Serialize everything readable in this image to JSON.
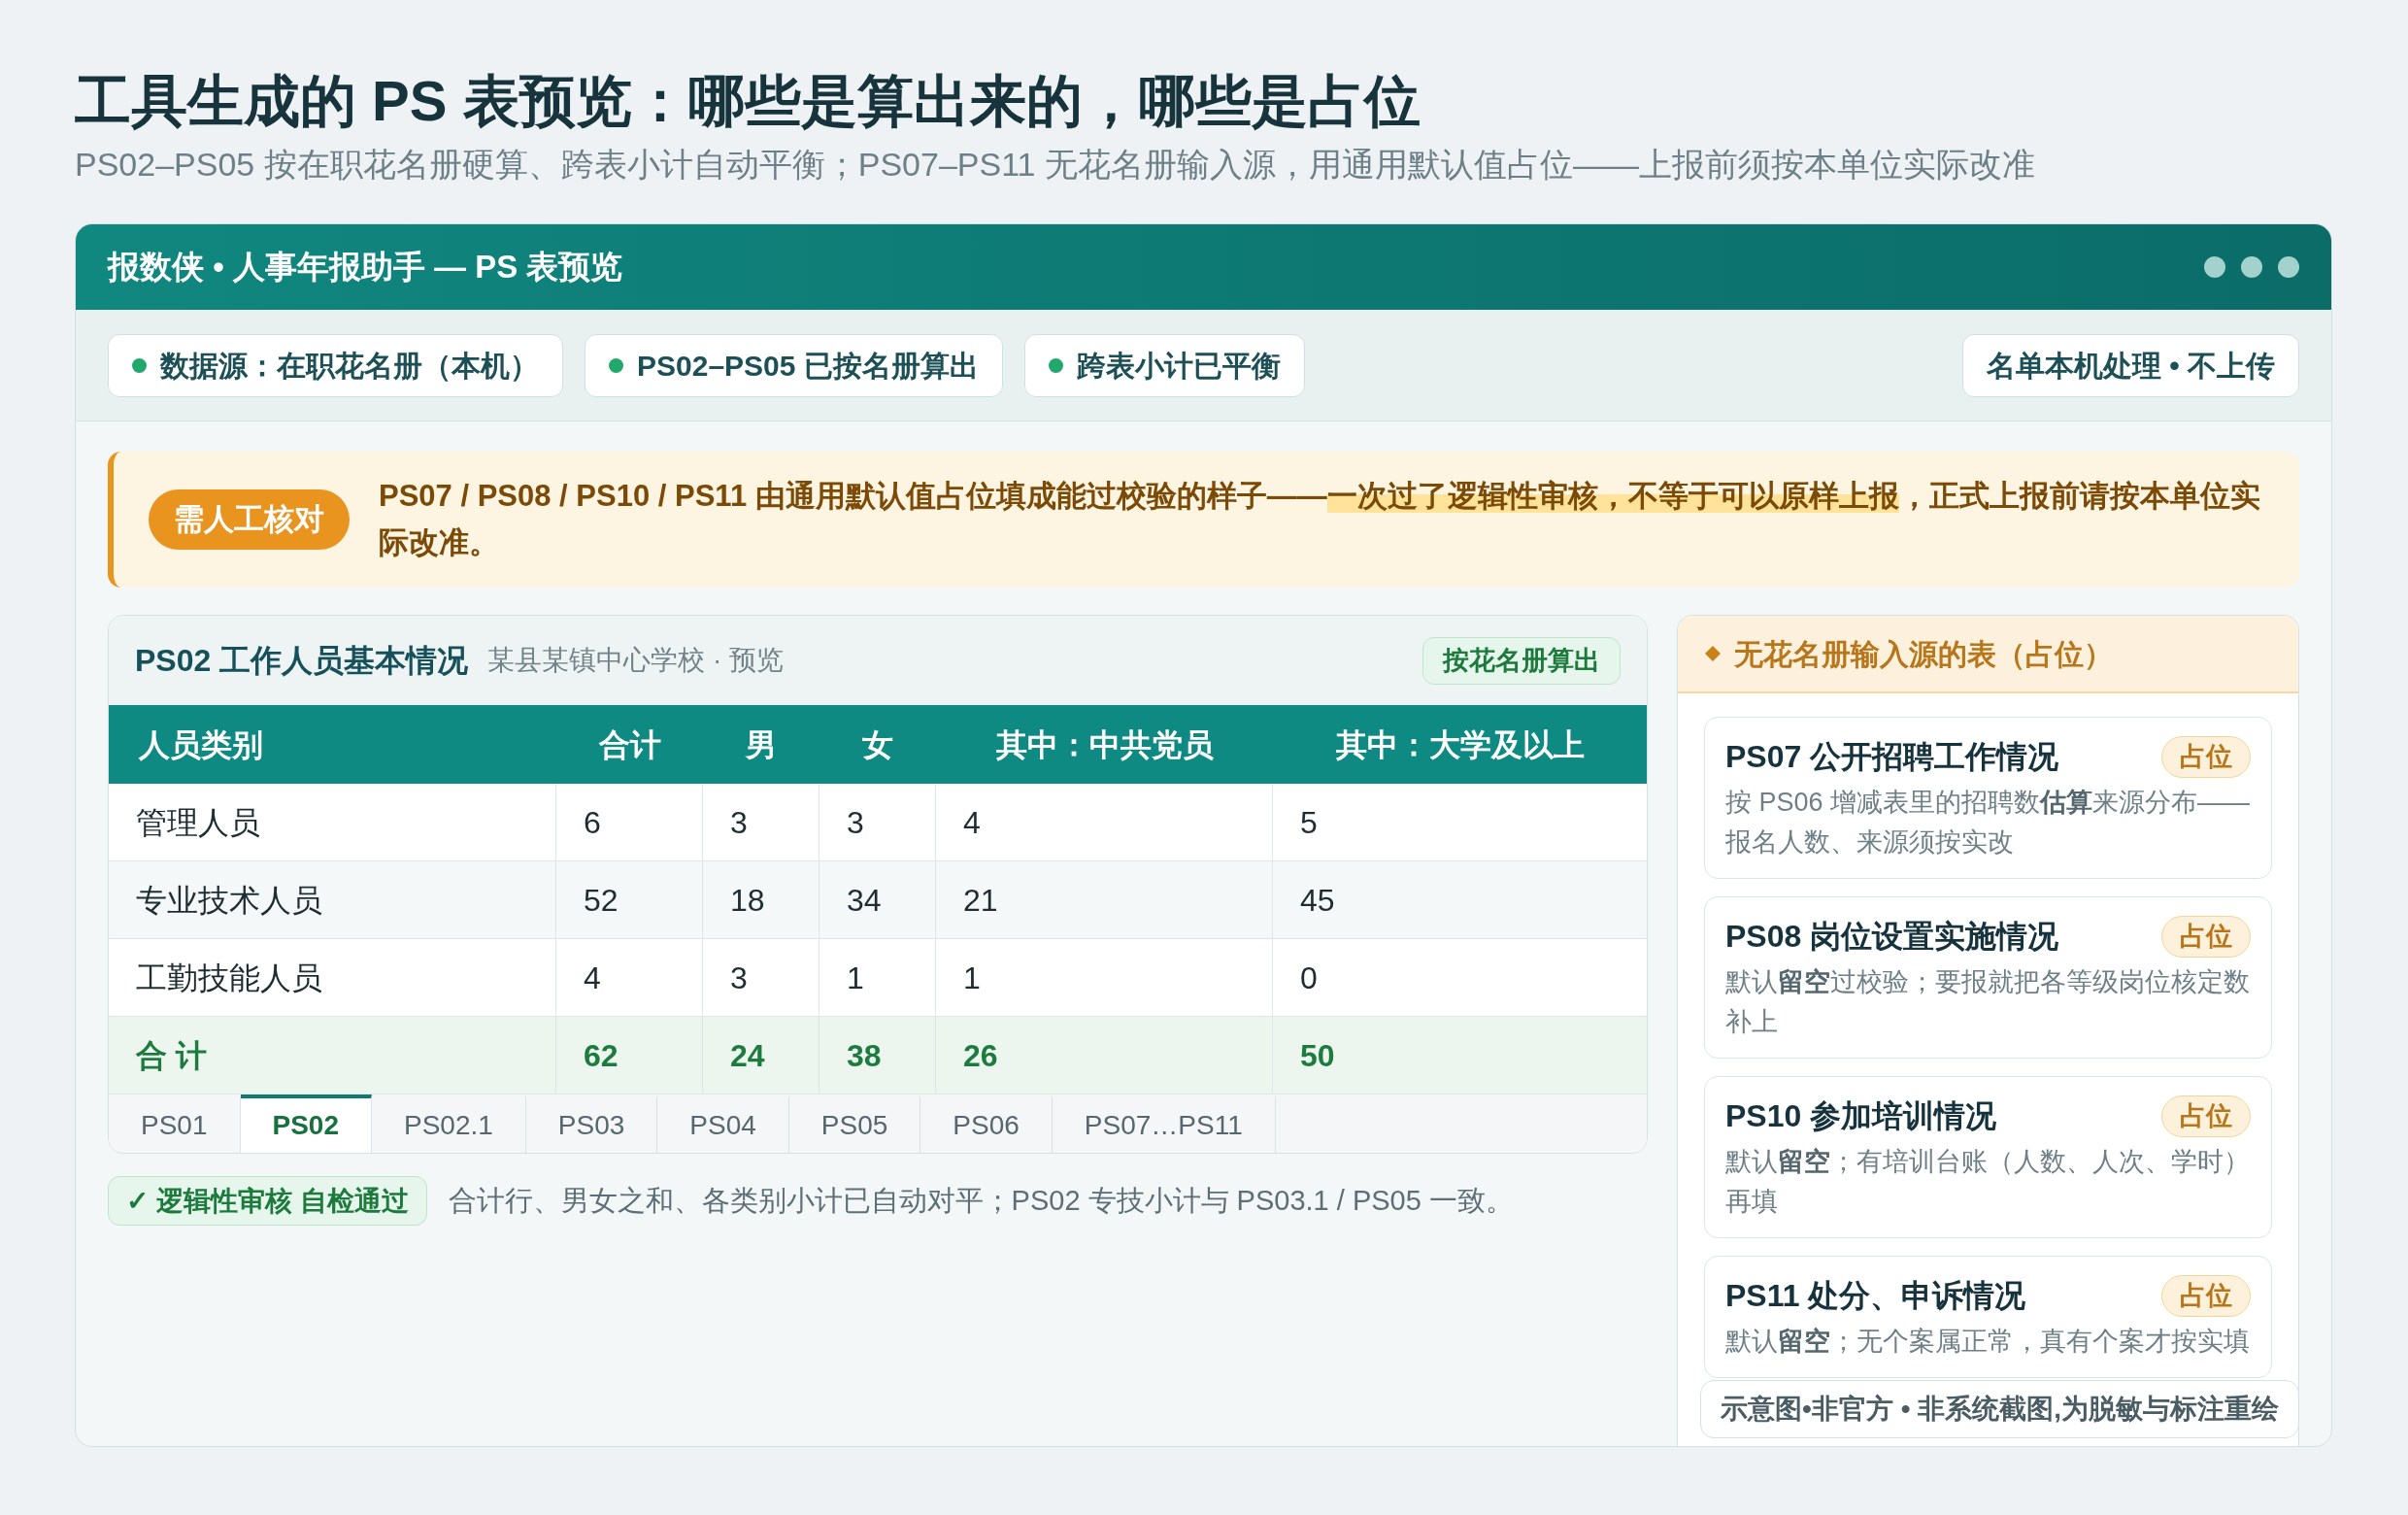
{
  "page": {
    "title": "工具生成的 PS 表预览：哪些是算出来的，哪些是占位",
    "subtitle": "PS02–PS05 按在职花名册硬算、跨表小计自动平衡；PS07–PS11 无花名册输入源，用通用默认值占位——上报前须按本单位实际改准"
  },
  "window": {
    "title": "报数侠 • 人事年报助手 — PS 表预览"
  },
  "status_chips": [
    {
      "label": "数据源：在职花名册（本机）",
      "kind": "dot"
    },
    {
      "label": "PS02–PS05 已按名册算出",
      "kind": "dot"
    },
    {
      "label": "跨表小计已平衡",
      "kind": "dot"
    },
    {
      "label": "名单本机处理 • 不上传",
      "kind": "plain"
    }
  ],
  "warning": {
    "badge": "需人工核对",
    "parts": [
      {
        "text": "PS07 / PS08 / PS10 / PS11 由通用默认值占位填成能过校验的样子——",
        "highlight": false
      },
      {
        "text": "一次过了逻辑性审核，不等于可以原样上报",
        "highlight": true
      },
      {
        "text": "，正式上报前请按本单位实际改准。",
        "highlight": false
      }
    ]
  },
  "table_card": {
    "title": "PS02 工作人员基本情况",
    "subtitle": "某县某镇中心学校 · 预览",
    "badge": "按花名册算出",
    "columns": [
      "人员类别",
      "合计",
      "男",
      "女",
      "其中：中共党员",
      "其中：大学及以上"
    ],
    "rows": [
      {
        "kind": "data",
        "cells": [
          "管理人员",
          "6",
          "3",
          "3",
          "4",
          "5"
        ]
      },
      {
        "kind": "data",
        "cells": [
          "专业技术人员",
          "52",
          "18",
          "34",
          "21",
          "45"
        ]
      },
      {
        "kind": "data",
        "cells": [
          "工勤技能人员",
          "4",
          "3",
          "1",
          "1",
          "0"
        ]
      },
      {
        "kind": "total",
        "cells": [
          "合 计",
          "62",
          "24",
          "38",
          "26",
          "50"
        ]
      }
    ],
    "sheet_tabs": [
      {
        "label": "PS01",
        "selected": false
      },
      {
        "label": "PS02",
        "selected": true
      },
      {
        "label": "PS02.1",
        "selected": false
      },
      {
        "label": "PS03",
        "selected": false
      },
      {
        "label": "PS04",
        "selected": false
      },
      {
        "label": "PS05",
        "selected": false
      },
      {
        "label": "PS06",
        "selected": false
      },
      {
        "label": "PS07…PS11",
        "selected": false
      }
    ]
  },
  "check": {
    "badge": "✓ 逻辑性审核 自检通过",
    "note": "合计行、男女之和、各类别小计已自动对平；PS02 专技小计与 PS03.1 / PS05 一致。"
  },
  "placeholder_panel": {
    "title": "无花名册输入源的表（占位）",
    "cards": [
      {
        "title": "PS07 公开招聘工作情况",
        "tag": "占位",
        "description": "按 PS06 增减表里的招聘数**估算**来源分布——报名人数、来源须按实改"
      },
      {
        "title": "PS08 岗位设置实施情况",
        "tag": "占位",
        "description": "默认**留空**过校验；要报就把各等级岗位核定数补上"
      },
      {
        "title": "PS10 参加培训情况",
        "tag": "占位",
        "description": "默认**留空**；有培训台账（人数、人次、学时）再填"
      },
      {
        "title": "PS11 处分、申诉情况",
        "tag": "占位",
        "description": "默认**留空**；无个案属正常，真有个案才按实填"
      }
    ]
  },
  "disclaimer": "示意图•非官方 • 非系统截图,为脱敏与标注重绘"
}
